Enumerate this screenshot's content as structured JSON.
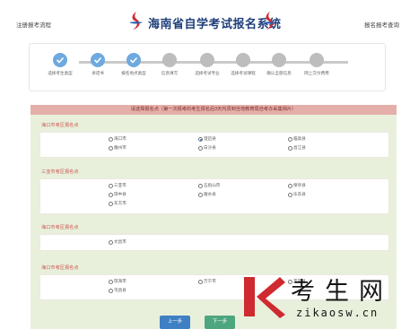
{
  "header": {
    "left_link": "注册报考流程",
    "title": "海南省自学考试报名系统",
    "right_link": "报名报考查询"
  },
  "stepper": {
    "steps": [
      {
        "label": "选择考生类型",
        "state": "done"
      },
      {
        "label": "承诺书",
        "state": "done"
      },
      {
        "label": "报名地点类型",
        "state": "done"
      },
      {
        "label": "信息填写",
        "state": "pending"
      },
      {
        "label": "选择考试专业",
        "state": "pending"
      },
      {
        "label": "选择考试课程",
        "state": "pending"
      },
      {
        "label": "确认全部信息",
        "state": "pending"
      },
      {
        "label": "网上交付费用",
        "state": "pending"
      }
    ]
  },
  "notice": "请选择报名点（第一次报考的考生报名后3天内须到当地教育局自考办采集相片）",
  "regions": [
    {
      "title": "海口市考区报名点",
      "options": [
        {
          "label": "海口市",
          "selected": false
        },
        {
          "label": "澄迈县",
          "selected": true
        },
        {
          "label": "临高县",
          "selected": false
        },
        {
          "label": "儋州市",
          "selected": false
        },
        {
          "label": "白沙县",
          "selected": false
        },
        {
          "label": "昌江县",
          "selected": false
        }
      ]
    },
    {
      "title": "三亚市考区报名点",
      "options": [
        {
          "label": "三亚市",
          "selected": false
        },
        {
          "label": "五指山市",
          "selected": false
        },
        {
          "label": "保亭县",
          "selected": false
        },
        {
          "label": "琼中县",
          "selected": false
        },
        {
          "label": "陵水县",
          "selected": false
        },
        {
          "label": "乐东县",
          "selected": false
        },
        {
          "label": "东方市",
          "selected": false
        }
      ]
    },
    {
      "title": "海口市考区报名点",
      "options": [
        {
          "label": "文昌市",
          "selected": false
        }
      ]
    },
    {
      "title": "海口市考区报名点",
      "options": [
        {
          "label": "琼海市",
          "selected": false
        },
        {
          "label": "万宁市",
          "selected": false
        },
        {
          "label": "定安县",
          "selected": false
        },
        {
          "label": "屯昌县",
          "selected": false
        }
      ]
    }
  ],
  "buttons": {
    "prev": "上一步",
    "next": "下一步"
  },
  "watermark": {
    "text": "考生网",
    "url": "zikaosw.cn"
  },
  "colors": {
    "title": "#1f3f7a",
    "step_done": "#6ea9df",
    "step_pending": "#bdbdbd",
    "banner": "#e5afa9",
    "content_bg": "#e8f0dc",
    "region_title": "#d05454",
    "btn_prev": "#3f7fc4",
    "btn_next": "#4ea67f",
    "watermark_k": "#cf2a2f"
  }
}
